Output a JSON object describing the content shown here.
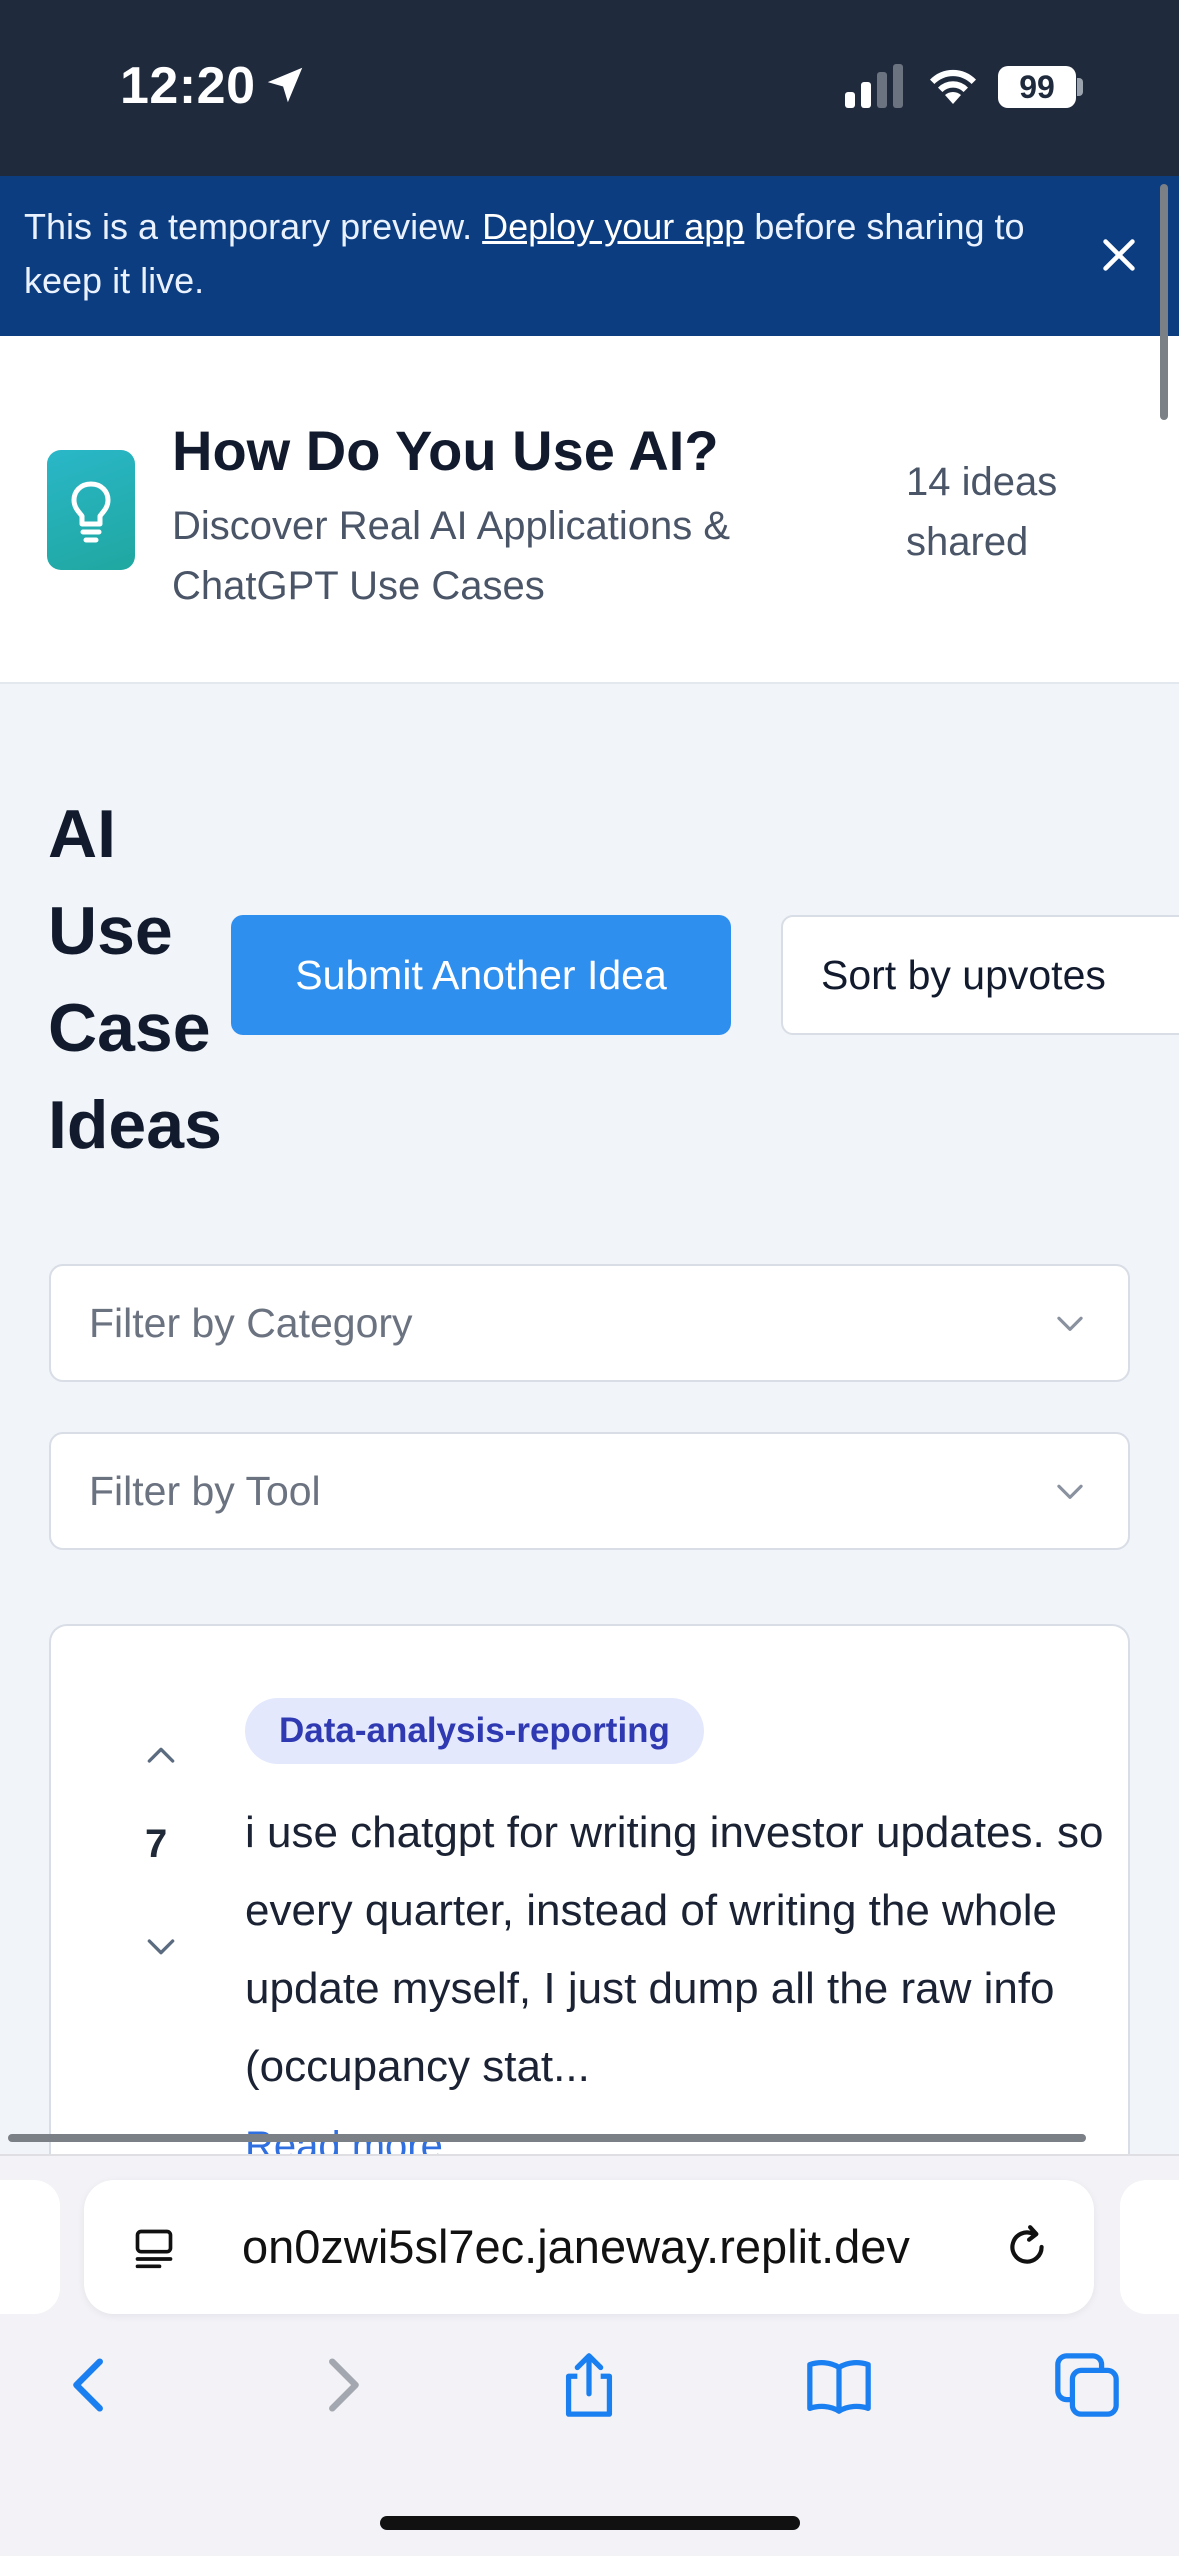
{
  "status_bar": {
    "time": "12:20",
    "battery": "99"
  },
  "banner": {
    "text_before": "This is a temporary preview. ",
    "link_text": "Deploy your app",
    "text_after": " before sharing to keep it live."
  },
  "header": {
    "title": "How Do You Use AI?",
    "subtitle": "Discover Real AI Applications & ChatGPT Use Cases",
    "count": "14 ideas shared"
  },
  "section": {
    "title": "AI Use Case Ideas",
    "submit_label": "Submit Another Idea",
    "sort_label": "Sort by upvotes"
  },
  "filters": {
    "category_placeholder": "Filter by Category",
    "tool_placeholder": "Filter by Tool"
  },
  "ideas": [
    {
      "votes": "7",
      "category": "Data-analysis-reporting",
      "text": "i use chatgpt for writing investor updates. so every quarter, instead of writing the whole update myself, I just dump all the raw info (occupancy stat...",
      "read_more": "Read more"
    }
  ],
  "browser": {
    "url": "on0zwi5sl7ec.janeway.replit.dev"
  },
  "colors": {
    "banner_bg": "#0b3d80",
    "primary": "#2f8fef",
    "tag_bg": "#e3e8fd",
    "tag_text": "#2f3ab2",
    "logo": "#22b2bf"
  }
}
